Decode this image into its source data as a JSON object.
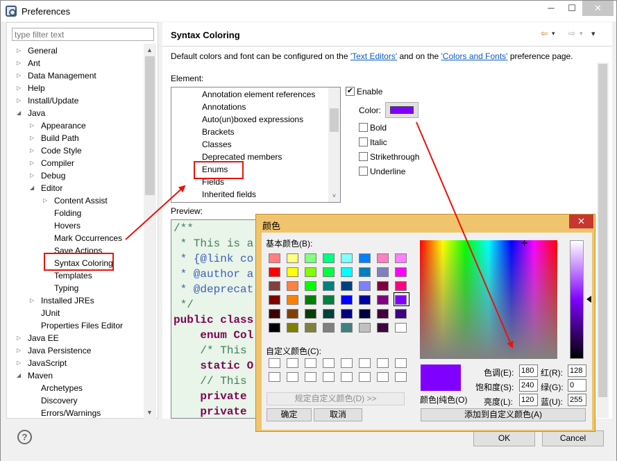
{
  "window": {
    "title": "Preferences",
    "minimize": "─",
    "maximize": "☐",
    "close": "✕"
  },
  "filter": {
    "placeholder": "type filter text"
  },
  "tree": [
    {
      "label": "General",
      "twisty": "▷",
      "level": 0
    },
    {
      "label": "Ant",
      "twisty": "▷",
      "level": 0
    },
    {
      "label": "Data Management",
      "twisty": "▷",
      "level": 0
    },
    {
      "label": "Help",
      "twisty": "▷",
      "level": 0
    },
    {
      "label": "Install/Update",
      "twisty": "▷",
      "level": 0
    },
    {
      "label": "Java",
      "twisty": "◢",
      "level": 0
    },
    {
      "label": "Appearance",
      "twisty": "▷",
      "level": 1
    },
    {
      "label": "Build Path",
      "twisty": "▷",
      "level": 1
    },
    {
      "label": "Code Style",
      "twisty": "▷",
      "level": 1
    },
    {
      "label": "Compiler",
      "twisty": "▷",
      "level": 1
    },
    {
      "label": "Debug",
      "twisty": "▷",
      "level": 1
    },
    {
      "label": "Editor",
      "twisty": "◢",
      "level": 1
    },
    {
      "label": "Content Assist",
      "twisty": "▷",
      "level": 2
    },
    {
      "label": "Folding",
      "twisty": "",
      "level": 2
    },
    {
      "label": "Hovers",
      "twisty": "",
      "level": 2
    },
    {
      "label": "Mark Occurrences",
      "twisty": "",
      "level": 2
    },
    {
      "label": "Save Actions",
      "twisty": "",
      "level": 2
    },
    {
      "label": "Syntax Coloring",
      "twisty": "",
      "level": 2
    },
    {
      "label": "Templates",
      "twisty": "",
      "level": 2
    },
    {
      "label": "Typing",
      "twisty": "",
      "level": 2
    },
    {
      "label": "Installed JREs",
      "twisty": "▷",
      "level": 1
    },
    {
      "label": "JUnit",
      "twisty": "",
      "level": 1
    },
    {
      "label": "Properties Files Editor",
      "twisty": "",
      "level": 1
    },
    {
      "label": "Java EE",
      "twisty": "▷",
      "level": 0
    },
    {
      "label": "Java Persistence",
      "twisty": "▷",
      "level": 0
    },
    {
      "label": "JavaScript",
      "twisty": "▷",
      "level": 0
    },
    {
      "label": "Maven",
      "twisty": "◢",
      "level": 0
    },
    {
      "label": "Archetypes",
      "twisty": "",
      "level": 1
    },
    {
      "label": "Discovery",
      "twisty": "",
      "level": 1
    },
    {
      "label": "Errors/Warnings",
      "twisty": "",
      "level": 1
    }
  ],
  "page": {
    "title": "Syntax Coloring",
    "desc_prefix": "Default colors and font can be configured on the ",
    "link1": "'Text Editors'",
    "desc_middle": " and on the ",
    "link2": "'Colors and Fonts'",
    "desc_suffix": " preference page.",
    "element_label": "Element:",
    "preview_label": "Preview:",
    "nav_back": "⇦",
    "nav_back_menu": "▾",
    "nav_fwd": "⇨",
    "nav_fwd_menu": "▾",
    "view_menu": "▾"
  },
  "elements": [
    "Annotation element references",
    "Annotations",
    "Auto(un)boxed expressions",
    "Brackets",
    "Classes",
    "Deprecated members",
    "Enums",
    "Fields",
    "Inherited fields"
  ],
  "options": {
    "enable": "Enable",
    "enable_check": "✔",
    "color_label": "Color:",
    "color_value": "#8000ff",
    "bold": "Bold",
    "italic": "Italic",
    "strikethrough": "Strikethrough",
    "underline": "Underline"
  },
  "code_lines": [
    {
      "text": "/**",
      "color": "#3f7f5f",
      "bold": false
    },
    {
      "text": " * This is a",
      "color": "#3f7f5f",
      "bold": false
    },
    {
      "text": " * {@link co",
      "color": "#3f5fbf",
      "bold": false
    },
    {
      "text": " * @author a",
      "color": "#3f5fbf",
      "bold": false
    },
    {
      "text": " * @deprecat",
      "color": "#3f5fbf",
      "bold": false
    },
    {
      "text": " */",
      "color": "#3f7f5f",
      "bold": false
    },
    {
      "text": "public class",
      "color": "#7f0055",
      "bold": true
    },
    {
      "text": "    enum Col",
      "color": "#7f0055",
      "bold": true
    },
    {
      "text": "    /* This ",
      "color": "#3f7f5f",
      "bold": false
    },
    {
      "text": "    static O",
      "color": "#7f0055",
      "bold": true
    },
    {
      "text": "    // This ",
      "color": "#3f7f5f",
      "bold": false
    },
    {
      "text": "    private ",
      "color": "#7f0055",
      "bold": true
    },
    {
      "text": "    private ",
      "color": "#7f0055",
      "bold": true
    }
  ],
  "buttons": {
    "help": "?",
    "ok": "OK",
    "cancel": "Cancel"
  },
  "dialog": {
    "title": "颜色",
    "close": "✕",
    "basic_label": "基本颜色(B):",
    "custom_label": "自定义颜色(C):",
    "define_custom": "规定自定义颜色(D) >>",
    "ok": "确定",
    "cancel": "取消",
    "color_solid": "颜色|纯色(O)",
    "hue_label": "色调(E):",
    "sat_label": "饱和度(S):",
    "lum_label": "亮度(L):",
    "red_label": "红(R):",
    "green_label": "绿(G):",
    "blue_label": "蓝(U):",
    "hue": "180",
    "sat": "240",
    "lum": "120",
    "red": "128",
    "green": "0",
    "blue": "255",
    "add_custom": "添加到自定义颜色(A)",
    "crosshair": "✛",
    "basic_colors": [
      [
        "#ff8080",
        "#ffff80",
        "#80ff80",
        "#00ff80",
        "#80ffff",
        "#0080ff",
        "#ff80c0",
        "#ff80ff"
      ],
      [
        "#ff0000",
        "#ffff00",
        "#80ff00",
        "#00ff40",
        "#00ffff",
        "#0080c0",
        "#8080c0",
        "#ff00ff"
      ],
      [
        "#804040",
        "#ff8040",
        "#00ff00",
        "#008080",
        "#004080",
        "#8080ff",
        "#800040",
        "#ff0080"
      ],
      [
        "#800000",
        "#ff8000",
        "#008000",
        "#008040",
        "#0000ff",
        "#0000a0",
        "#800080",
        "#8000ff"
      ],
      [
        "#400000",
        "#804000",
        "#004000",
        "#004040",
        "#000080",
        "#000040",
        "#400040",
        "#400080"
      ],
      [
        "#000000",
        "#808000",
        "#808040",
        "#808080",
        "#408080",
        "#c0c0c0",
        "#400040",
        "#ffffff"
      ]
    ]
  }
}
